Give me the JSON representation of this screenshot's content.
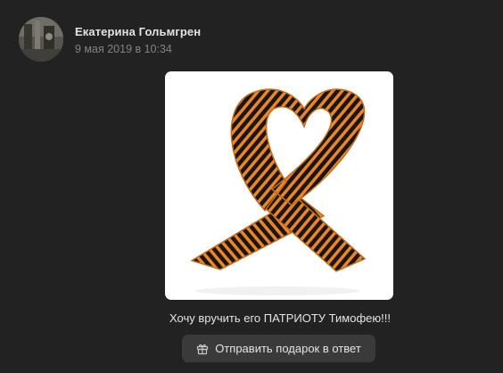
{
  "post": {
    "author_name": "Екатерина Гольмгрен",
    "date": "9 мая 2019 в 10:34"
  },
  "gift": {
    "image_name": "st-george-ribbon",
    "message": "Хочу вручить его ПАТРИОТУ Тимофею!!!",
    "reply_label": "Отправить подарок в ответ",
    "reply_icon": "gift-icon"
  },
  "colors": {
    "background": "#222222",
    "button_bg": "#3a3a3b",
    "text": "#e1e3e6",
    "muted": "#828282",
    "ribbon_orange": "#e9862a",
    "ribbon_black": "#1c1612"
  }
}
